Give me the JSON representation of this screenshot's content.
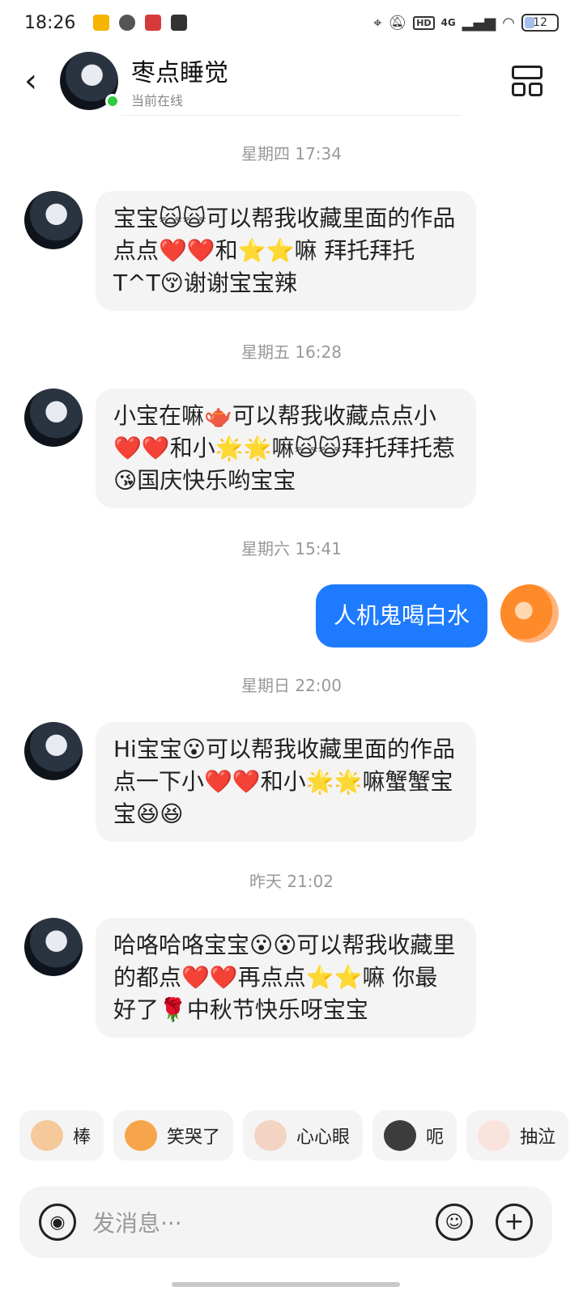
{
  "status_bar": {
    "time": "18:26",
    "network": "4G",
    "hd": "HD",
    "battery": "12"
  },
  "header": {
    "name": "枣点睡觉",
    "status": "当前在线"
  },
  "messages": [
    {
      "timestamp": "星期四 17:34",
      "text": "宝宝🙀🙀可以帮我收藏里面的作品点点❤️❤️和⭐⭐嘛 拜托拜托T^T😚谢谢宝宝辣"
    },
    {
      "timestamp": "星期五 16:28",
      "text": "小宝在嘛🫖可以帮我收藏点点小❤️❤️和小🌟🌟嘛🙀🙀拜托拜托惹😘国庆快乐哟宝宝"
    },
    {
      "timestamp": "星期六 15:41",
      "text": "人机鬼喝白水"
    },
    {
      "timestamp": "星期日 22:00",
      "text": "Hi宝宝😮可以帮我收藏里面的作品点一下小❤️❤️和小🌟🌟嘛蟹蟹宝宝😆😆"
    },
    {
      "timestamp": "昨天 21:02",
      "text": "哈咯哈咯宝宝😮😮可以帮我收藏里的都点❤️❤️再点点⭐⭐嘛 你最好了🌹中秋节快乐呀宝宝"
    }
  ],
  "quick_stickers": [
    "棒",
    "笑哭了",
    "心心眼",
    "呃",
    "抽泣"
  ],
  "input": {
    "placeholder": "发消息···"
  }
}
